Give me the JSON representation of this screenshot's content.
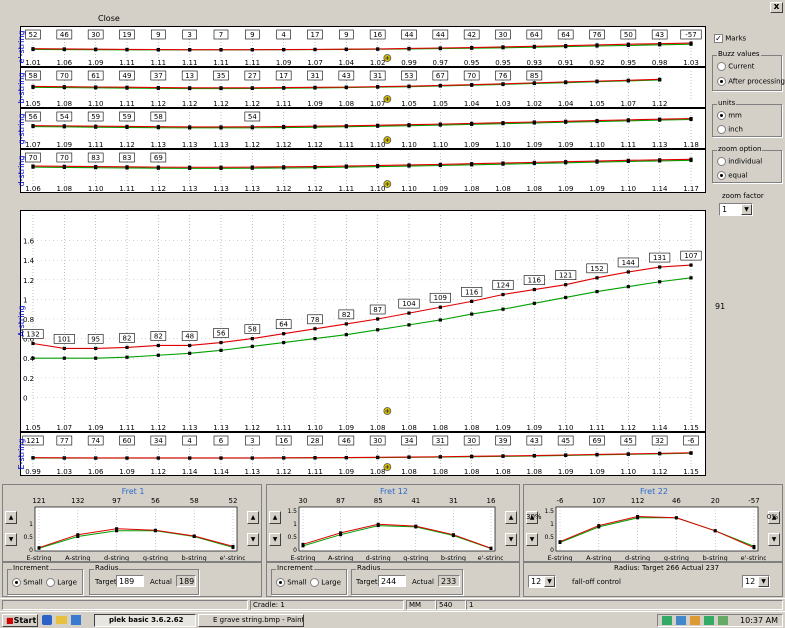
{
  "window": {
    "menu_close": "Close",
    "close_glyph": "x"
  },
  "strings": [
    {
      "id": "e",
      "label": "e'-string",
      "top": [
        "52",
        "46",
        "30",
        "19",
        "9",
        "3",
        "7",
        "9",
        "4",
        "17",
        "9",
        "16",
        "44",
        "44",
        "42",
        "30",
        "64",
        "64",
        "76",
        "50",
        "43",
        "-57"
      ],
      "bottom": [
        "1.01",
        "1.06",
        "1.09",
        "1.11",
        "1.11",
        "1.11",
        "1.11",
        "1.11",
        "1.09",
        "1.07",
        "1.04",
        "1.02",
        "0.99",
        "0.97",
        "0.95",
        "0.95",
        "0.93",
        "0.91",
        "0.92",
        "0.95",
        "0.98",
        "1.03"
      ],
      "ymin": -0.5,
      "ymax": 1.2,
      "red": [
        0.12,
        0.1,
        0.08,
        0.06,
        0.05,
        0.04,
        0.04,
        0.04,
        0.05,
        0.06,
        0.08,
        0.1,
        0.14,
        0.18,
        0.22,
        0.27,
        0.32,
        0.38,
        0.44,
        0.5,
        0.55,
        0.6
      ],
      "green": [
        0.06,
        0.05,
        0.04,
        0.03,
        0.02,
        0.02,
        0.02,
        0.03,
        0.04,
        0.05,
        0.06,
        0.08,
        0.1,
        0.13,
        0.16,
        0.2,
        0.25,
        0.3,
        0.35,
        0.4,
        0.45,
        0.5
      ]
    },
    {
      "id": "b",
      "label": "b-string",
      "top": [
        "58",
        "70",
        "61",
        "49",
        "37",
        "13",
        "35",
        "27",
        "17",
        "31",
        "43",
        "31",
        "53",
        "67",
        "70",
        "76",
        "85",
        "",
        "",
        "",
        "",
        ""
      ],
      "bottom": [
        "1.05",
        "1.08",
        "1.10",
        "1.11",
        "1.12",
        "1.12",
        "1.12",
        "1.12",
        "1.11",
        "1.09",
        "1.08",
        "1.07",
        "1.05",
        "1.05",
        "1.04",
        "1.03",
        "1.02",
        "1.04",
        "1.05",
        "1.07",
        "1.12",
        ""
      ],
      "ymin": -0.5,
      "ymax": 1.2,
      "red": [
        0.4,
        0.38,
        0.35,
        0.33,
        0.3,
        0.28,
        0.28,
        0.28,
        0.3,
        0.32,
        0.34,
        0.38,
        0.42,
        0.48,
        0.55,
        0.62,
        0.7,
        0.78,
        0.85,
        0.92,
        1.0
      ],
      "green": [
        0.32,
        0.3,
        0.28,
        0.26,
        0.24,
        0.22,
        0.22,
        0.23,
        0.25,
        0.27,
        0.3,
        0.34,
        0.38,
        0.44,
        0.5,
        0.57,
        0.65,
        0.72,
        0.8,
        0.87,
        0.95
      ]
    },
    {
      "id": "g",
      "label": "g-string",
      "top": [
        "56",
        "54",
        "59",
        "59",
        "58",
        "",
        "",
        "54",
        "",
        "",
        "",
        "",
        "",
        "",
        "",
        "",
        "",
        "",
        "",
        "",
        "",
        ""
      ],
      "bottom": [
        "1.07",
        "1.09",
        "1.11",
        "1.12",
        "1.13",
        "1.13",
        "1.13",
        "1.12",
        "1.12",
        "1.12",
        "1.11",
        "1.10",
        "1.10",
        "1.10",
        "1.09",
        "1.10",
        "1.09",
        "1.09",
        "1.10",
        "1.11",
        "1.13",
        "1.18"
      ],
      "ymin": -0.5,
      "ymax": 1.2,
      "red": [
        0.55,
        0.53,
        0.5,
        0.48,
        0.46,
        0.44,
        0.44,
        0.45,
        0.47,
        0.5,
        0.54,
        0.58,
        0.63,
        0.68,
        0.74,
        0.8,
        0.86,
        0.92,
        0.98,
        1.04,
        1.1,
        1.15
      ],
      "green": [
        0.47,
        0.45,
        0.42,
        0.4,
        0.38,
        0.36,
        0.36,
        0.37,
        0.39,
        0.42,
        0.46,
        0.5,
        0.55,
        0.6,
        0.66,
        0.72,
        0.78,
        0.84,
        0.9,
        0.96,
        1.02,
        1.08
      ]
    },
    {
      "id": "d",
      "label": "d-string",
      "top": [
        "70",
        "70",
        "83",
        "83",
        "69",
        "",
        "",
        "",
        "",
        "",
        "",
        "",
        "",
        "",
        "",
        "",
        "",
        "",
        "",
        "",
        "",
        ""
      ],
      "bottom": [
        "1.06",
        "1.08",
        "1.10",
        "1.11",
        "1.12",
        "1.13",
        "1.13",
        "1.13",
        "1.12",
        "1.12",
        "1.11",
        "1.10",
        "1.10",
        "1.09",
        "1.08",
        "1.08",
        "1.08",
        "1.09",
        "1.09",
        "1.10",
        "1.14",
        "1.17"
      ],
      "ymin": -0.5,
      "ymax": 1.2,
      "red": [
        0.68,
        0.66,
        0.64,
        0.62,
        0.6,
        0.59,
        0.59,
        0.6,
        0.62,
        0.64,
        0.68,
        0.72,
        0.76,
        0.8,
        0.85,
        0.9,
        0.95,
        1.0,
        1.05,
        1.1,
        1.14,
        1.18
      ],
      "green": [
        0.6,
        0.58,
        0.56,
        0.54,
        0.52,
        0.51,
        0.51,
        0.52,
        0.54,
        0.56,
        0.6,
        0.64,
        0.68,
        0.72,
        0.77,
        0.82,
        0.87,
        0.92,
        0.97,
        1.02,
        1.06,
        1.1
      ]
    },
    {
      "id": "A",
      "label": "A-string",
      "top": [
        "132",
        "101",
        "95",
        "82",
        "82",
        "48",
        "56",
        "58",
        "64",
        "78",
        "82",
        "87",
        "104",
        "109",
        "116",
        "124",
        "116",
        "121",
        "152",
        "144",
        "131",
        "107"
      ],
      "bottom": [
        "1.05",
        "1.07",
        "1.09",
        "1.11",
        "1.12",
        "1.13",
        "1.13",
        "1.12",
        "1.11",
        "1.10",
        "1.09",
        "1.08",
        "1.08",
        "1.08",
        "1.08",
        "1.09",
        "1.09",
        "1.10",
        "1.11",
        "1.12",
        "1.14",
        "1.15"
      ],
      "ymin": -0.2,
      "ymax": 1.8,
      "ticks": [
        0,
        0.2,
        0.4,
        0.6,
        0.8,
        1,
        1.2,
        1.4,
        1.6
      ],
      "red": [
        0.55,
        0.5,
        0.5,
        0.51,
        0.53,
        0.53,
        0.56,
        0.6,
        0.65,
        0.7,
        0.75,
        0.8,
        0.86,
        0.92,
        0.98,
        1.05,
        1.1,
        1.15,
        1.22,
        1.28,
        1.33,
        1.35
      ],
      "green": [
        0.4,
        0.4,
        0.4,
        0.41,
        0.43,
        0.45,
        0.48,
        0.52,
        0.56,
        0.6,
        0.64,
        0.69,
        0.74,
        0.79,
        0.85,
        0.9,
        0.96,
        1.02,
        1.08,
        1.13,
        1.18,
        1.22
      ],
      "side_value": "91"
    },
    {
      "id": "E",
      "label": "E-string",
      "top": [
        "121",
        "77",
        "74",
        "60",
        "34",
        "4",
        "6",
        "3",
        "16",
        "28",
        "46",
        "30",
        "34",
        "31",
        "30",
        "39",
        "43",
        "45",
        "69",
        "45",
        "32",
        "-6"
      ],
      "bottom": [
        "0.99",
        "1.03",
        "1.06",
        "1.09",
        "1.12",
        "1.14",
        "1.14",
        "1.13",
        "1.12",
        "1.11",
        "1.09",
        "1.08",
        "1.08",
        "1.08",
        "1.08",
        "1.08",
        "1.08",
        "1.09",
        "1.09",
        "1.10",
        "1.12",
        "1.15"
      ],
      "ymin": -0.5,
      "ymax": 1.2,
      "red": [
        0.04,
        0.03,
        0.02,
        0.02,
        0.02,
        0.02,
        0.02,
        0.02,
        0.03,
        0.04,
        0.05,
        0.07,
        0.09,
        0.11,
        0.14,
        0.17,
        0.2,
        0.24,
        0.28,
        0.32,
        0.36,
        0.4
      ],
      "green": [
        0.02,
        0.01,
        0.01,
        0.01,
        0.01,
        0.01,
        0.01,
        0.01,
        0.02,
        0.03,
        0.04,
        0.05,
        0.07,
        0.09,
        0.11,
        0.14,
        0.17,
        0.21,
        0.25,
        0.29,
        0.33,
        0.37
      ]
    }
  ],
  "right_panel": {
    "marks_label": "Marks",
    "marks_checked": true,
    "buzz_title": "Buzz values",
    "buzz_opts": [
      "Current",
      "After processing"
    ],
    "buzz_selected": 1,
    "units_title": "units",
    "units_opts": [
      "mm",
      "inch"
    ],
    "units_selected": 0,
    "zoom_title": "zoom option",
    "zoom_opts": [
      "individual",
      "equal"
    ],
    "zoom_selected": 1,
    "zoom_factor_title": "zoom factor",
    "zoom_factor_value": "1"
  },
  "frets": [
    {
      "title": "Fret 1",
      "values": [
        "121",
        "132",
        "97",
        "56",
        "58",
        "52"
      ],
      "red": [
        0.05,
        0.55,
        0.78,
        0.72,
        0.5,
        0.1
      ],
      "green": [
        0.03,
        0.48,
        0.7,
        0.7,
        0.48,
        0.06
      ]
    },
    {
      "title": "Fret 12",
      "values": [
        "30",
        "87",
        "85",
        "41",
        "31",
        "16"
      ],
      "red": [
        0.18,
        0.62,
        0.95,
        0.88,
        0.55,
        0.03
      ],
      "green": [
        0.12,
        0.55,
        0.9,
        0.85,
        0.52,
        0.02
      ]
    },
    {
      "title": "Fret 22",
      "values": [
        "-6",
        "107",
        "112",
        "46",
        "20",
        "-57"
      ],
      "red": [
        0.28,
        0.9,
        1.25,
        1.2,
        0.7,
        0.05
      ],
      "green": [
        0.25,
        0.85,
        1.2,
        1.2,
        0.7,
        0.1
      ]
    }
  ],
  "fret_strings": [
    "E-string",
    "A-string",
    "d-string",
    "g-string",
    "b-string",
    "e'-string"
  ],
  "fret_axis": {
    "t0": "0",
    "t1": "0.5",
    "t2": "1",
    "t3": "1.5"
  },
  "controls1": {
    "increment_title": "Increment",
    "small": "Small",
    "large": "Large",
    "radius_title": "Radius",
    "target_label": "Target",
    "target_value": "189",
    "actual_label": "Actual",
    "actual_value": "189"
  },
  "controls2": {
    "increment_title": "Increment",
    "small": "Small",
    "large": "Large",
    "radius_title": "Radius",
    "target_label": "Target",
    "target_value": "244",
    "actual_label": "Actual",
    "actual_value": "233"
  },
  "controls3": {
    "radius_text": "Radius:  Target 266  Actual 237",
    "left_select": "12",
    "right_select": "12",
    "falloff": "fall-off control",
    "pct_left": "30%",
    "pct_right": "0%"
  },
  "status": {
    "cradle": "Cradle: 1",
    "unit": "MM",
    "value": "540",
    "num": "1"
  },
  "taskbar": {
    "start": "Start",
    "task1": "plek basic 3.6.2.62",
    "task2": "E grave string.bmp - Paint",
    "time": "10:37 AM"
  }
}
